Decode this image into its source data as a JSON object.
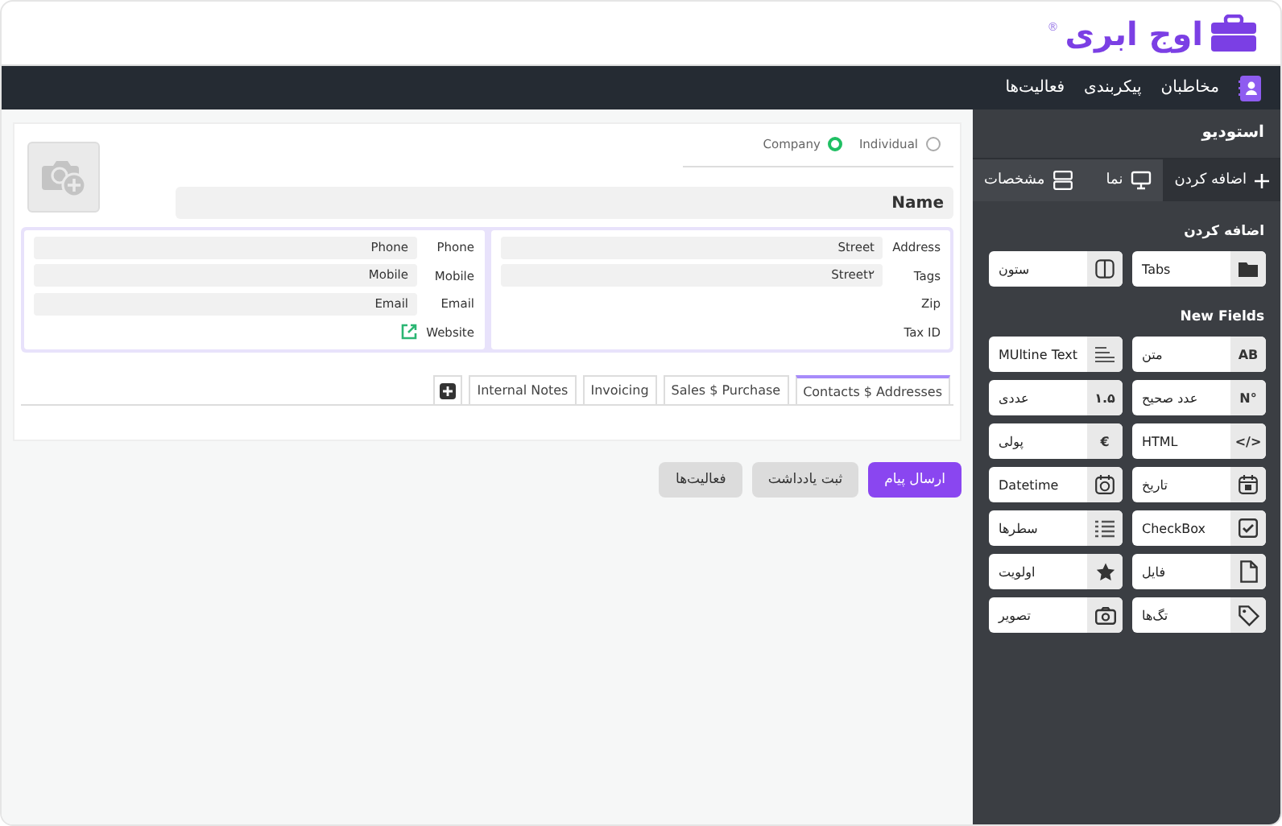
{
  "logo": {
    "text": "اوج ابری",
    "mark": "®"
  },
  "nav": {
    "items": [
      {
        "label": "مخاطبان",
        "kind": "contacts"
      },
      {
        "label": "پیکربندی",
        "kind": "plain"
      },
      {
        "label": "فعالیت‌ها",
        "kind": "plain"
      }
    ]
  },
  "form": {
    "type_options": [
      {
        "label": "Individual",
        "selected": false
      },
      {
        "label": "Company",
        "selected": true
      }
    ],
    "name": "Name",
    "right_panel": [
      {
        "label": "Address",
        "value": "Street"
      },
      {
        "label": "Tags",
        "value": "Street۲"
      },
      {
        "label": "Zip"
      },
      {
        "label": "Tax ID"
      }
    ],
    "left_panel": [
      {
        "label": "Phone",
        "value": "Phone",
        "kind": "field"
      },
      {
        "label": "Mobile",
        "value": "Mobile",
        "kind": "field"
      },
      {
        "label": "Email",
        "value": "Email",
        "kind": "field"
      },
      {
        "label": "Website",
        "kind": "link"
      }
    ],
    "tabs": [
      {
        "label": "Contacts $ Addresses",
        "selected": true
      },
      {
        "label": "Sales $ Purchase",
        "selected": false
      },
      {
        "label": "Invoicing",
        "selected": false
      },
      {
        "label": "Internal Notes",
        "selected": false
      }
    ]
  },
  "actions": [
    {
      "label": "ارسال پیام",
      "kind": "primary"
    },
    {
      "label": "ثبت یادداشت",
      "kind": "secondary"
    },
    {
      "label": "فعالیت‌ها",
      "kind": "secondary"
    }
  ],
  "sidebar": {
    "title": "استودیو",
    "tabs": [
      {
        "label": "اضافه کردن",
        "kind": "plus",
        "selected": true
      },
      {
        "label": "نما",
        "kind": "monitor",
        "selected": false
      },
      {
        "label": "مشخصات",
        "kind": "server",
        "selected": false
      }
    ],
    "sections": [
      {
        "title": "اضافه کردن",
        "items": [
          {
            "label": "Tabs",
            "icon": {
              "kind": "folder"
            }
          },
          {
            "label": "ستون",
            "icon": {
              "kind": "column"
            }
          }
        ]
      },
      {
        "title": "New Fields",
        "items": [
          {
            "label": "متن",
            "icon": {
              "kind": "glyph",
              "text": "AB"
            }
          },
          {
            "label": "MUltine Text",
            "icon": {
              "kind": "lines"
            }
          },
          {
            "label": "عدد صحیح",
            "icon": {
              "kind": "glyph",
              "text": "N°"
            }
          },
          {
            "label": "عددی",
            "icon": {
              "kind": "glyph",
              "text": "۱.۵"
            }
          },
          {
            "label": "HTML",
            "icon": {
              "kind": "glyph",
              "text": "</>"
            }
          },
          {
            "label": "پولی",
            "icon": {
              "kind": "glyph",
              "text": "€"
            }
          },
          {
            "label": "تاریخ",
            "icon": {
              "kind": "calendar"
            }
          },
          {
            "label": "Datetime",
            "icon": {
              "kind": "clock"
            }
          },
          {
            "label": "CheckBox",
            "icon": {
              "kind": "checkbox"
            }
          },
          {
            "label": "سطرها",
            "icon": {
              "kind": "list"
            }
          },
          {
            "label": "فایل",
            "icon": {
              "kind": "file"
            }
          },
          {
            "label": "اولویت",
            "icon": {
              "kind": "star"
            }
          },
          {
            "label": "تگ‌ها",
            "icon": {
              "kind": "tag"
            }
          },
          {
            "label": "تصویر",
            "icon": {
              "kind": "camera"
            }
          }
        ]
      }
    ]
  }
}
